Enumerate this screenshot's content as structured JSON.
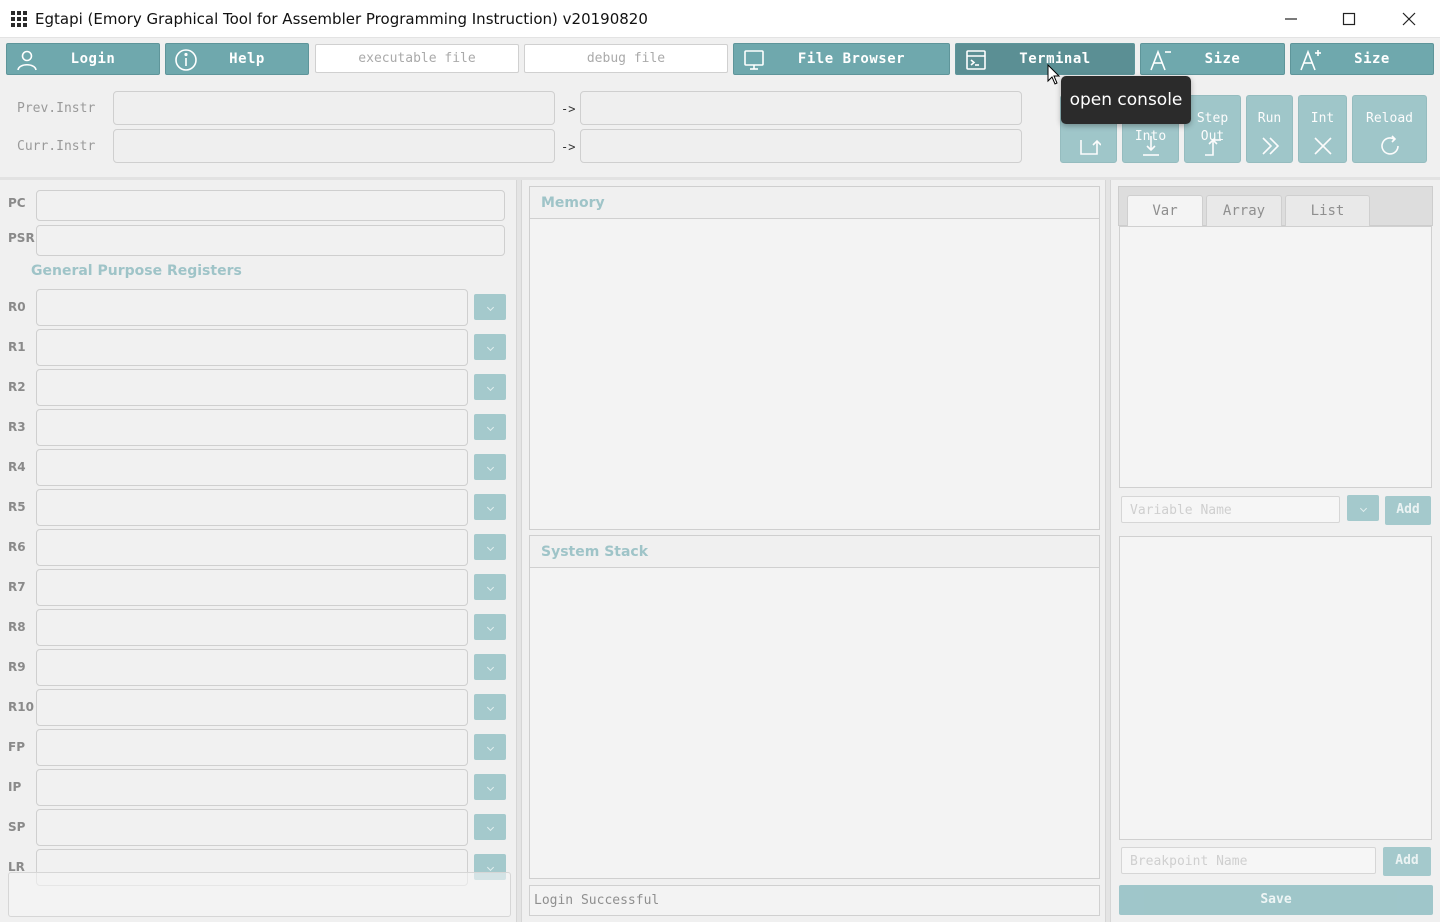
{
  "window": {
    "title": "Egtapi (Emory Graphical Tool for Assembler Programming Instruction) v20190820"
  },
  "toolbar": {
    "login_label": "Login",
    "help_label": "Help",
    "exec_placeholder": "executable file",
    "debug_placeholder": "debug file",
    "file_browser_label": "File Browser",
    "terminal_label": "Terminal",
    "size_down_label": "Size",
    "size_up_label": "Size"
  },
  "instr": {
    "prev_label": "Prev.Instr",
    "curr_label": "Curr.Instr",
    "arrow": "->"
  },
  "controls": {
    "step_over_line2": "",
    "step_into_line1": "",
    "step_into_line2": "Into",
    "step_out_line1": "Step",
    "step_out_line2": "Out",
    "run": "Run",
    "int": "Int",
    "reload": "Reload"
  },
  "tooltip": {
    "text": "open console"
  },
  "registers": {
    "pc_label": "PC",
    "psr_label": "PSR",
    "gpr_title": "General Purpose Registers",
    "list": [
      "R0",
      "R1",
      "R2",
      "R3",
      "R4",
      "R5",
      "R6",
      "R7",
      "R8",
      "R9",
      "R10",
      "FP",
      "IP",
      "SP",
      "LR"
    ]
  },
  "memory": {
    "title": "Memory"
  },
  "stack": {
    "title": "System Stack"
  },
  "status": {
    "text": "Login Successful"
  },
  "watch": {
    "tabs": [
      "Var",
      "Array",
      "List"
    ],
    "variable_placeholder": "Variable Name",
    "add_label": "Add",
    "breakpoint_placeholder": "Breakpoint Name",
    "bp_add_label": "Add",
    "save_label": "Save"
  },
  "colors": {
    "accent": "#6fa8ad",
    "accent_disabled": "#8bbcc0",
    "header_text": "#9fc4c8"
  }
}
